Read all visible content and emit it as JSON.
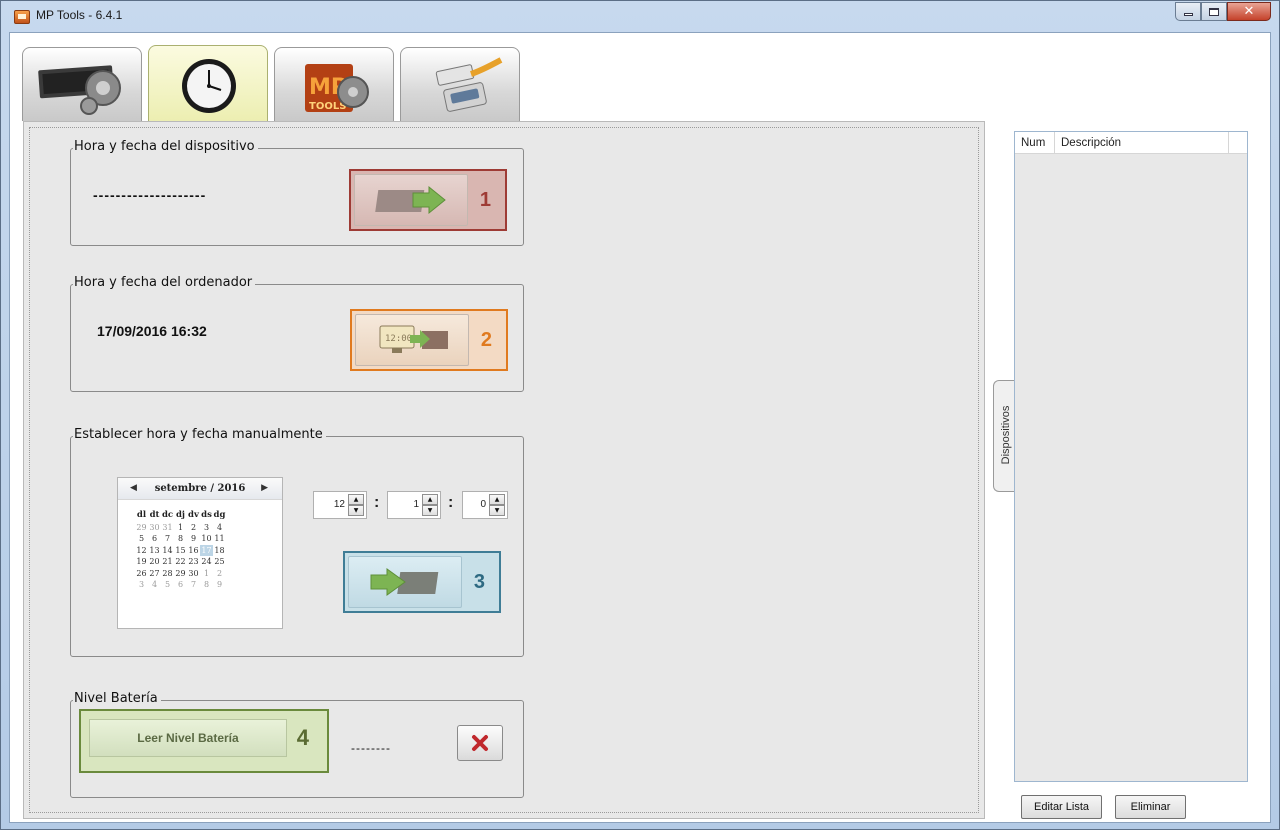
{
  "window": {
    "title": "MP Tools - 6.4.1"
  },
  "tabs": [
    {
      "icon": "device-gear-icon"
    },
    {
      "icon": "clock-icon"
    },
    {
      "icon": "mp-tools-logo-icon"
    },
    {
      "icon": "serial-cable-icon"
    }
  ],
  "device_time": {
    "title": "Hora y fecha del dispositivo",
    "value": "--------------------",
    "button_number": "1",
    "accent": "#9e3b35"
  },
  "computer_time": {
    "title": "Hora y fecha del ordenador",
    "value": "17/09/2016  16:32",
    "button_number": "2",
    "accent": "#e07a1f"
  },
  "manual_time": {
    "title": "Establecer hora y fecha manualmente",
    "calendar": {
      "month_label": "setembre / 2016",
      "weekdays": [
        "dl",
        "dt",
        "dc",
        "dj",
        "dv",
        "ds",
        "dg"
      ],
      "weeks": [
        [
          "29",
          "30",
          "31",
          "1",
          "2",
          "3",
          "4"
        ],
        [
          "5",
          "6",
          "7",
          "8",
          "9",
          "10",
          "11"
        ],
        [
          "12",
          "13",
          "14",
          "15",
          "16",
          "17",
          "18"
        ],
        [
          "19",
          "20",
          "21",
          "22",
          "23",
          "24",
          "25"
        ],
        [
          "26",
          "27",
          "28",
          "29",
          "30",
          "1",
          "2"
        ],
        [
          "3",
          "4",
          "5",
          "6",
          "7",
          "8",
          "9"
        ]
      ],
      "selected_day": "17"
    },
    "hour": "12",
    "minute": "1",
    "second": "0",
    "separator": ":",
    "button_number": "3",
    "accent": "#3f7d96"
  },
  "battery": {
    "title": "Nivel Batería",
    "button_label": "Leer Nivel Batería",
    "button_number": "4",
    "value": "--------",
    "accent": "#6a8a3c"
  },
  "side_tab": {
    "label": "Dispositivos"
  },
  "device_list": {
    "columns": [
      "Num",
      "Descripción"
    ],
    "rows": []
  },
  "buttons": {
    "edit_list": "Editar Lista",
    "delete": "Eliminar"
  }
}
